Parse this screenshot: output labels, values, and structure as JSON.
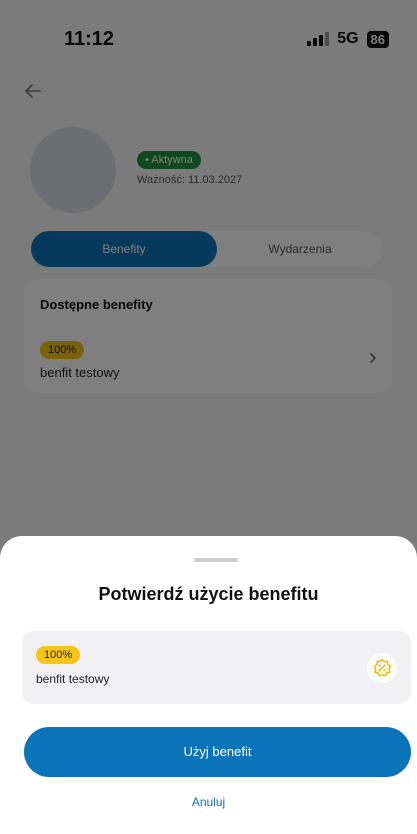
{
  "status_bar": {
    "time": "11:12",
    "network": "5G",
    "battery": "86"
  },
  "profile": {
    "status": "• Aktywna",
    "validity": "Ważność: 11.03.2027"
  },
  "tabs": [
    {
      "label": "Benefity",
      "active": true
    },
    {
      "label": "Wydarzenia",
      "active": false
    }
  ],
  "benefits_card": {
    "title": "Dostępne benefity",
    "item": {
      "discount": "100%",
      "name": "benfit testowy"
    }
  },
  "sheet": {
    "title": "Potwierdź użycie benefitu",
    "item": {
      "discount": "100%",
      "name": "benfit testowy"
    },
    "icon": "discount-badge-icon",
    "primary_button": "Użyj benefit",
    "cancel": "Anuluj"
  },
  "colors": {
    "primary": "#0b74b8",
    "badge_yellow": "#f5c518",
    "active_green": "#1f8f3f"
  }
}
